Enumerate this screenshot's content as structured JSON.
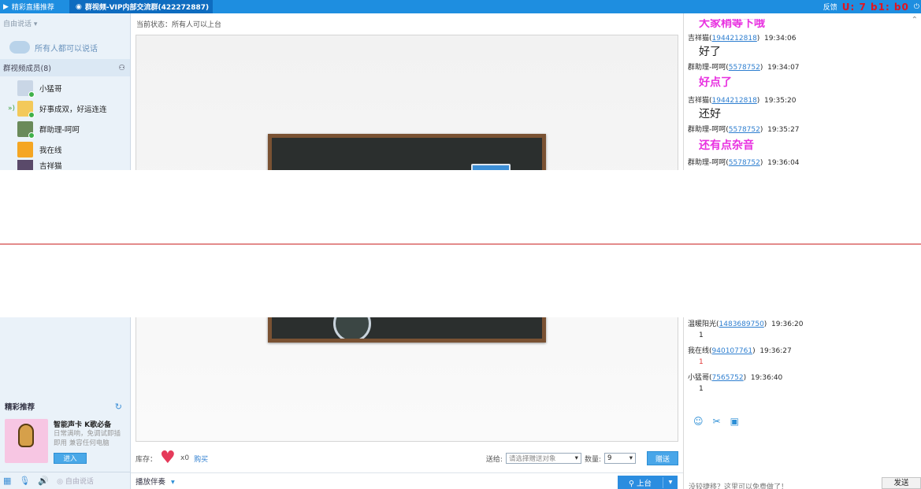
{
  "titlebar": {
    "tabs": [
      {
        "label": "精彩直播推荐"
      },
      {
        "label": "群视频-VIP内部交流群(422272887)"
      }
    ],
    "right_label": "反馈",
    "red_text": "U: 7 b1: b0"
  },
  "sidebar": {
    "mode": "自由说话",
    "all_can_speak": "所有人都可以说话",
    "members_header": "群视频成员(8)",
    "members": [
      {
        "name": "小猛哥",
        "speaking": false
      },
      {
        "name": "好事成双，好运连连",
        "speaking": true
      },
      {
        "name": "群助理-呵呵",
        "speaking": false
      },
      {
        "name": "我在线",
        "speaking": false
      },
      {
        "name": "吉祥猫",
        "speaking": false
      }
    ],
    "recommend": {
      "header": "精彩推荐",
      "title": "智能声卡 K歌必备",
      "desc": "日常满响，免调试即插即用 兼容任何电脑",
      "enter": "进入"
    },
    "bottom_mode": "自由说话"
  },
  "main": {
    "status": "当前状态：所有人可以上台",
    "stock_label": "库存：",
    "stock_count": "x0",
    "buy": "购买",
    "give_to": "送给:",
    "give_to_placeholder": "请选择赠送对象",
    "qty_label": "数量:",
    "qty_value": "9",
    "give_btn": "赠送",
    "play_companion": "播放伴奏",
    "on_stage": "上台"
  },
  "chat": {
    "messages_top": [
      {
        "kind": "big",
        "text": "大家稍等下哦",
        "style": "pink"
      },
      {
        "kind": "meta",
        "name": "吉祥猫",
        "id": "1944212818",
        "time": "19:34:06"
      },
      {
        "kind": "big",
        "text": "好了",
        "style": "dark"
      },
      {
        "kind": "meta",
        "name": "群助理-呵呵",
        "id": "5578752",
        "time": "19:34:07"
      },
      {
        "kind": "big",
        "text": "好点了",
        "style": "pink"
      },
      {
        "kind": "meta",
        "name": "吉祥猫",
        "id": "1944212818",
        "time": "19:35:20"
      },
      {
        "kind": "big",
        "text": "还好",
        "style": "dark"
      },
      {
        "kind": "meta",
        "name": "群助理-呵呵",
        "id": "5578752",
        "time": "19:35:27"
      },
      {
        "kind": "big",
        "text": "还有点杂音",
        "style": "pink"
      },
      {
        "kind": "meta",
        "name": "群助理-呵呵",
        "id": "5578752",
        "time": "19:36:04"
      }
    ],
    "messages_bottom": [
      {
        "kind": "meta",
        "name": "温暖阳光",
        "id": "1483689750",
        "time": "19:36:20"
      },
      {
        "kind": "small",
        "text": "1",
        "style": "dark"
      },
      {
        "kind": "meta",
        "name": "我在线",
        "id": "940107761",
        "time": "19:36:27"
      },
      {
        "kind": "small",
        "text": "1",
        "style": "red"
      },
      {
        "kind": "meta",
        "name": "小猛哥",
        "id": "7565752",
        "time": "19:36:40"
      },
      {
        "kind": "small",
        "text": "1",
        "style": "dark"
      }
    ],
    "input_hint": "没较捷移？这里可以免费做了！",
    "send": "发送"
  },
  "colors": {
    "titlebar": "#1e8ee0",
    "accent_pink": "#e831e0",
    "link": "#2f7fd0"
  }
}
